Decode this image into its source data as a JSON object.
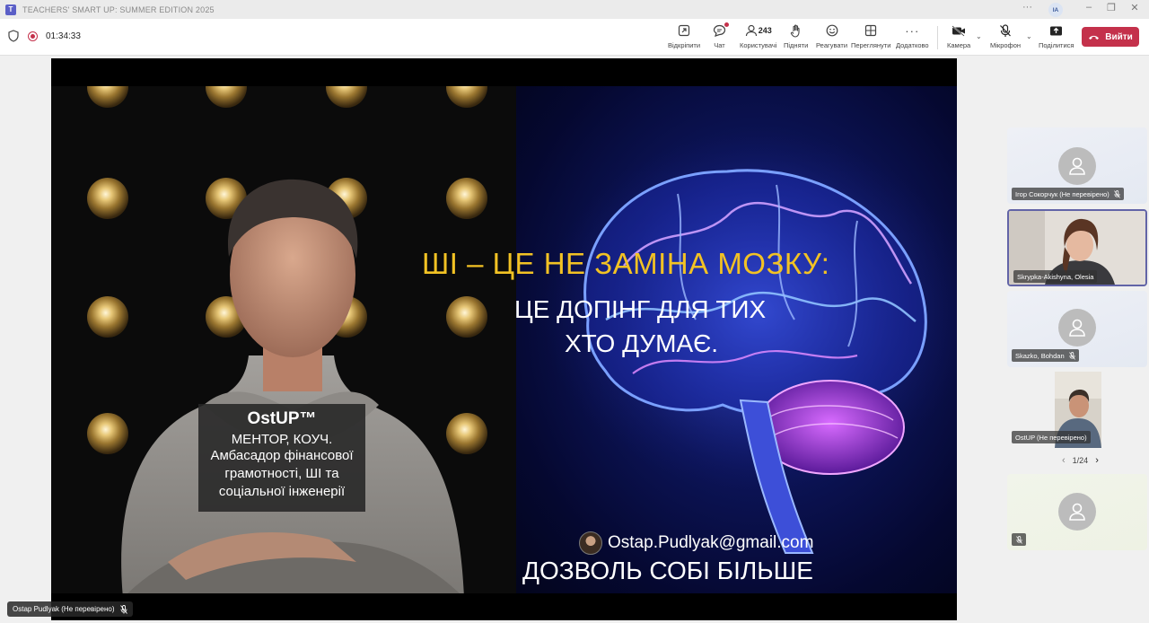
{
  "window": {
    "title": "TEACHERS' SMART UP: SUMMER EDITION 2025",
    "app_icon": "teams-icon",
    "user_initials": "IA"
  },
  "toolbar": {
    "timer": "01:34:33",
    "buttons": {
      "open": "Відкріпити",
      "chat": "Чат",
      "people": "Користувачі",
      "people_count": "243",
      "raise": "Підняти",
      "react": "Реагувати",
      "view": "Переглянути",
      "more": "Додатково",
      "camera": "Камера",
      "mic": "Мікрофон",
      "share": "Поділитися"
    },
    "leave_label": "Вийти"
  },
  "slide": {
    "headline": "ШІ – ЦЕ НЕ ЗАМІНА МОЗКУ:",
    "sub_line1": "ЦЕ ДОПІНГ ДЛЯ ТИХ",
    "sub_line2": "ХТО ДУМАЄ.",
    "card": {
      "brand": "OstUP™",
      "role": "МЕНТОР, КОУЧ.",
      "desc_line1": "Амбасадор фінансової",
      "desc_line2": "грамотності, ШІ та",
      "desc_line3": "соціальної інженерії"
    },
    "email": "Ostap.Pudlyak@gmail.com",
    "tagline": "ДОЗВОЛЬ СОБІ БІЛЬШЕ"
  },
  "presenter": {
    "name": "Ostap Pudlyak (Не перевірено)"
  },
  "participants": [
    {
      "name": "Ігор Сокорчук (Не перевірено)",
      "video": false,
      "muted": true
    },
    {
      "name": "Skrypka-Akishyna, Olesia",
      "video": true,
      "muted": false,
      "speaking": true
    },
    {
      "name": "Skazko, Bohdan",
      "video": false,
      "muted": true
    },
    {
      "name": "OstUP (Не перевірено)",
      "video": true,
      "muted": false
    },
    {
      "name": "",
      "video": false,
      "muted": true
    }
  ],
  "pager": {
    "label": "1/24"
  },
  "colors": {
    "accent": "#5b5fc7",
    "leave": "#c4314b",
    "headline": "#f2c224",
    "speaking_border": "#6264a7"
  }
}
